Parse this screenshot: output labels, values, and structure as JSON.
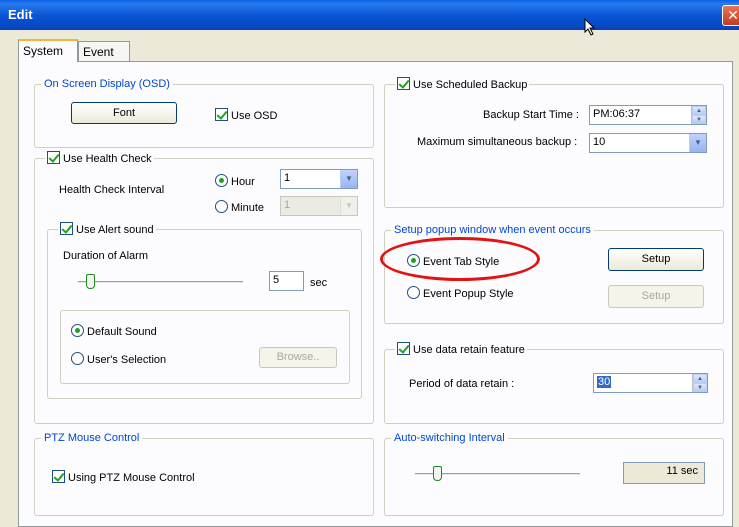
{
  "window": {
    "title": "Edit",
    "close_glyph": "✕"
  },
  "tabs": [
    {
      "label": "System",
      "active": true
    },
    {
      "label": "Event",
      "active": false
    }
  ],
  "osd": {
    "group_label": "On Screen Display (OSD)",
    "font_button": "Font",
    "use_osd_label": "Use OSD",
    "use_osd_checked": true
  },
  "health": {
    "use_label": "Use Health Check",
    "checked": true,
    "interval_label": "Health Check Interval",
    "hour_label": "Hour",
    "minute_label": "Minute",
    "hour_value": "1",
    "minute_value": "1",
    "selected_unit": "Hour"
  },
  "alert": {
    "use_label": "Use Alert sound",
    "checked": true,
    "duration_label": "Duration of Alarm",
    "duration_value": "5",
    "duration_unit": "sec",
    "default_sound_label": "Default Sound",
    "user_selection_label": "User's Selection",
    "browse_button": "Browse..",
    "selected_sound": "Default Sound"
  },
  "ptz": {
    "group_label": "PTZ Mouse Control",
    "checkbox_label": "Using PTZ Mouse Control",
    "checked": true
  },
  "backup": {
    "use_label": "Use Scheduled Backup",
    "checked": true,
    "start_time_label": "Backup Start Time :",
    "start_time_value": "PM:06:37",
    "max_label": "Maximum simultaneous backup :",
    "max_value": "10"
  },
  "popup": {
    "group_label": "Setup popup window when event occurs",
    "event_tab_label": "Event Tab Style",
    "event_popup_label": "Event Popup Style",
    "setup_button": "Setup",
    "setup_button_disabled": "Setup",
    "selected_style": "Event Tab Style"
  },
  "retain": {
    "use_label": "Use data retain feature",
    "checked": true,
    "period_label": "Period of data retain :",
    "period_value": "30"
  },
  "auto_switch": {
    "group_label": "Auto-switching Interval",
    "value_display": "11 sec"
  },
  "colors": {
    "titlebar": "#0856d4",
    "group_label": "#0046d5",
    "highlight_circle": "#e01414",
    "check_mark": "#21a121"
  }
}
